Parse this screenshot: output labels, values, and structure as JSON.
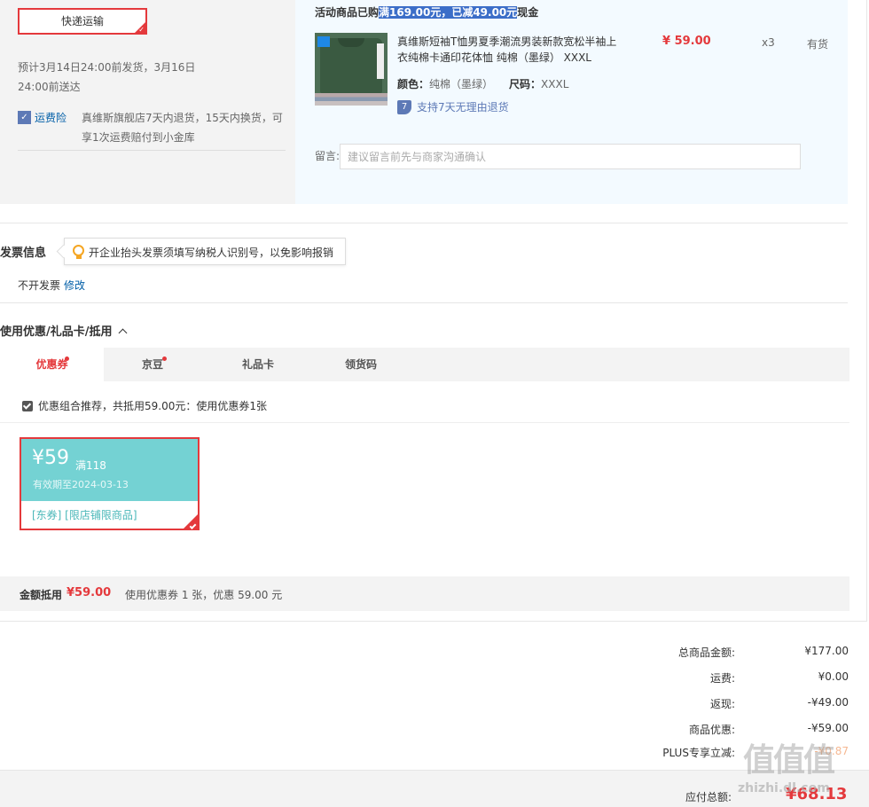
{
  "shipping": {
    "method_label": "快递运输",
    "eta_text": "预计3月14日24:00前发货，3月16日24:00前送达",
    "insurance_name": "运费险",
    "insurance_desc": "真维斯旗舰店7天内退货，15天内换货，可享1次运费赔付到小金库"
  },
  "order": {
    "promo_prefix": "活动商品已购",
    "promo_highlight": "满169.00元，已减49.00元",
    "promo_suffix": "现金",
    "product": {
      "title": "真维斯短袖T恤男夏季潮流男装新款宽松半袖上衣纯棉卡通印花体恤 纯棉（墨绿） XXXL",
      "color_label": "颜色：",
      "color_value": "纯棉（墨绿）",
      "size_label": "尺码：",
      "size_value": "XXXL",
      "return_policy": "支持7天无理由退货",
      "price": "¥ 59.00",
      "quantity": "x3",
      "stock": "有货"
    },
    "message_label": "留言:",
    "message_placeholder": "建议留言前先与商家沟通确认"
  },
  "invoice": {
    "title": "发票信息",
    "tip": "开企业抬头发票须填写纳税人识别号，以免影响报销",
    "status": "不开发票",
    "edit_label": "修改"
  },
  "discount": {
    "title": "使用优惠/礼品卡/抵用",
    "tabs": [
      {
        "label": "优惠券"
      },
      {
        "label": "京豆"
      },
      {
        "label": "礼品卡"
      },
      {
        "label": "领货码"
      }
    ],
    "combo_text": "优惠组合推荐，共抵用59.00元：使用优惠券1张",
    "coupon": {
      "amount": "¥59",
      "condition": "满118",
      "expiry": "有效期至2024-03-13",
      "tags": "[东券]  [限店铺限商品]"
    },
    "deduct_label": "金额抵用",
    "deduct_amount": "¥59.00",
    "deduct_desc": "使用优惠券 1 张，优惠 59.00 元"
  },
  "summary": {
    "rows": [
      {
        "label": "总商品金额:",
        "value": "¥177.00"
      },
      {
        "label": "运费:",
        "value": "¥0.00"
      },
      {
        "label": "返现:",
        "value": "-¥49.00"
      },
      {
        "label": "商品优惠:",
        "value": "-¥59.00"
      },
      {
        "label": "PLUS专享立减:",
        "value": "-¥0.87"
      }
    ],
    "total_label": "应付总额:",
    "total_value": "¥68.13"
  },
  "watermark": {
    "glyphs": "值值值",
    "url": "zhizhi.dl.com"
  },
  "colors": {
    "accent": "#e4393c",
    "link": "#005ea7",
    "coupon": "#74d2d3",
    "highlight": "#3c6ec8"
  }
}
